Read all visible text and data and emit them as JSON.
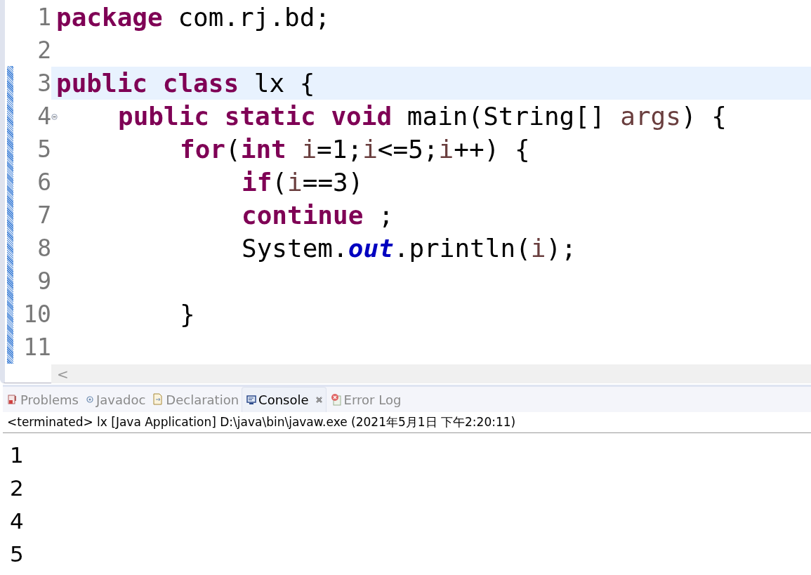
{
  "editor": {
    "lines": [
      {
        "number": "1",
        "current": false,
        "tokens": [
          {
            "kind": "keyword",
            "text": "package"
          },
          {
            "kind": "plain",
            "text": " com.rj.bd;"
          }
        ]
      },
      {
        "number": "2",
        "current": false
      },
      {
        "number": "3",
        "current": true,
        "tokens": [
          {
            "kind": "keyword",
            "text": "public"
          },
          {
            "kind": "keyword",
            "text": " class"
          },
          {
            "kind": "plain",
            "text": " lx {"
          }
        ],
        "children": [
          {
            "number": "4",
            "current": false,
            "fold": true,
            "tokens": [
              {
                "kind": "keyword",
                "text": "public"
              },
              {
                "kind": "keyword",
                "text": " static"
              },
              {
                "kind": "keyword",
                "text": " void"
              },
              {
                "kind": "plain",
                "text": " main(String[] "
              },
              {
                "kind": "variable",
                "text": "args"
              },
              {
                "kind": "plain",
                "text": ") {"
              }
            ],
            "children": [
              {
                "number": "5",
                "current": false,
                "tokens": [
                  {
                    "kind": "keyword",
                    "text": "for"
                  },
                  {
                    "kind": "plain",
                    "text": "("
                  },
                  {
                    "kind": "keyword",
                    "text": "int"
                  },
                  {
                    "kind": "variable",
                    "text": " i"
                  },
                  {
                    "kind": "plain",
                    "text": "=1;"
                  },
                  {
                    "kind": "variable",
                    "text": "i"
                  },
                  {
                    "kind": "plain",
                    "text": "<=5;"
                  },
                  {
                    "kind": "variable",
                    "text": "i"
                  },
                  {
                    "kind": "plain",
                    "text": "++) {"
                  }
                ],
                "children": [
                  {
                    "number": "6",
                    "current": false,
                    "tokens": [
                      {
                        "kind": "keyword",
                        "text": "if"
                      },
                      {
                        "kind": "plain",
                        "text": "("
                      },
                      {
                        "kind": "variable",
                        "text": "i"
                      },
                      {
                        "kind": "plain",
                        "text": "==3)"
                      }
                    ]
                  },
                  {
                    "number": "7",
                    "current": false,
                    "tokens": [
                      {
                        "kind": "keyword",
                        "text": "continue"
                      },
                      {
                        "kind": "plain",
                        "text": " ;"
                      }
                    ]
                  },
                  {
                    "number": "8",
                    "current": false,
                    "tokens": [
                      {
                        "kind": "plain",
                        "text": "System."
                      },
                      {
                        "kind": "field",
                        "text": "out"
                      },
                      {
                        "kind": "plain",
                        "text": ".println("
                      },
                      {
                        "kind": "variable",
                        "text": "i"
                      },
                      {
                        "kind": "plain",
                        "text": ");"
                      }
                    ]
                  },
                  {
                    "number": "9",
                    "current": false
                  }
                ]
              },
              {
                "number": "10",
                "current": false,
                "tokens": [
                  {
                    "kind": "plain",
                    "text": "}"
                  }
                ]
              }
            ]
          }
        ]
      },
      {
        "number": "11",
        "current": false
      }
    ],
    "scroll_left": "<"
  },
  "panel": {
    "tabs": [
      {
        "label": "Problems",
        "selected": false
      },
      {
        "label": "Javadoc",
        "selected": false
      },
      {
        "label": "Declaration",
        "selected": false
      },
      {
        "label": "Console",
        "selected": true,
        "closable": true
      },
      {
        "label": "Error Log",
        "selected": false
      }
    ],
    "status": "<terminated> lx [Java Application] D:\\java\\bin\\javaw.exe (2021年5月1日 下午2:20:11)",
    "output": [
      "1",
      "2",
      "4",
      "5"
    ]
  }
}
